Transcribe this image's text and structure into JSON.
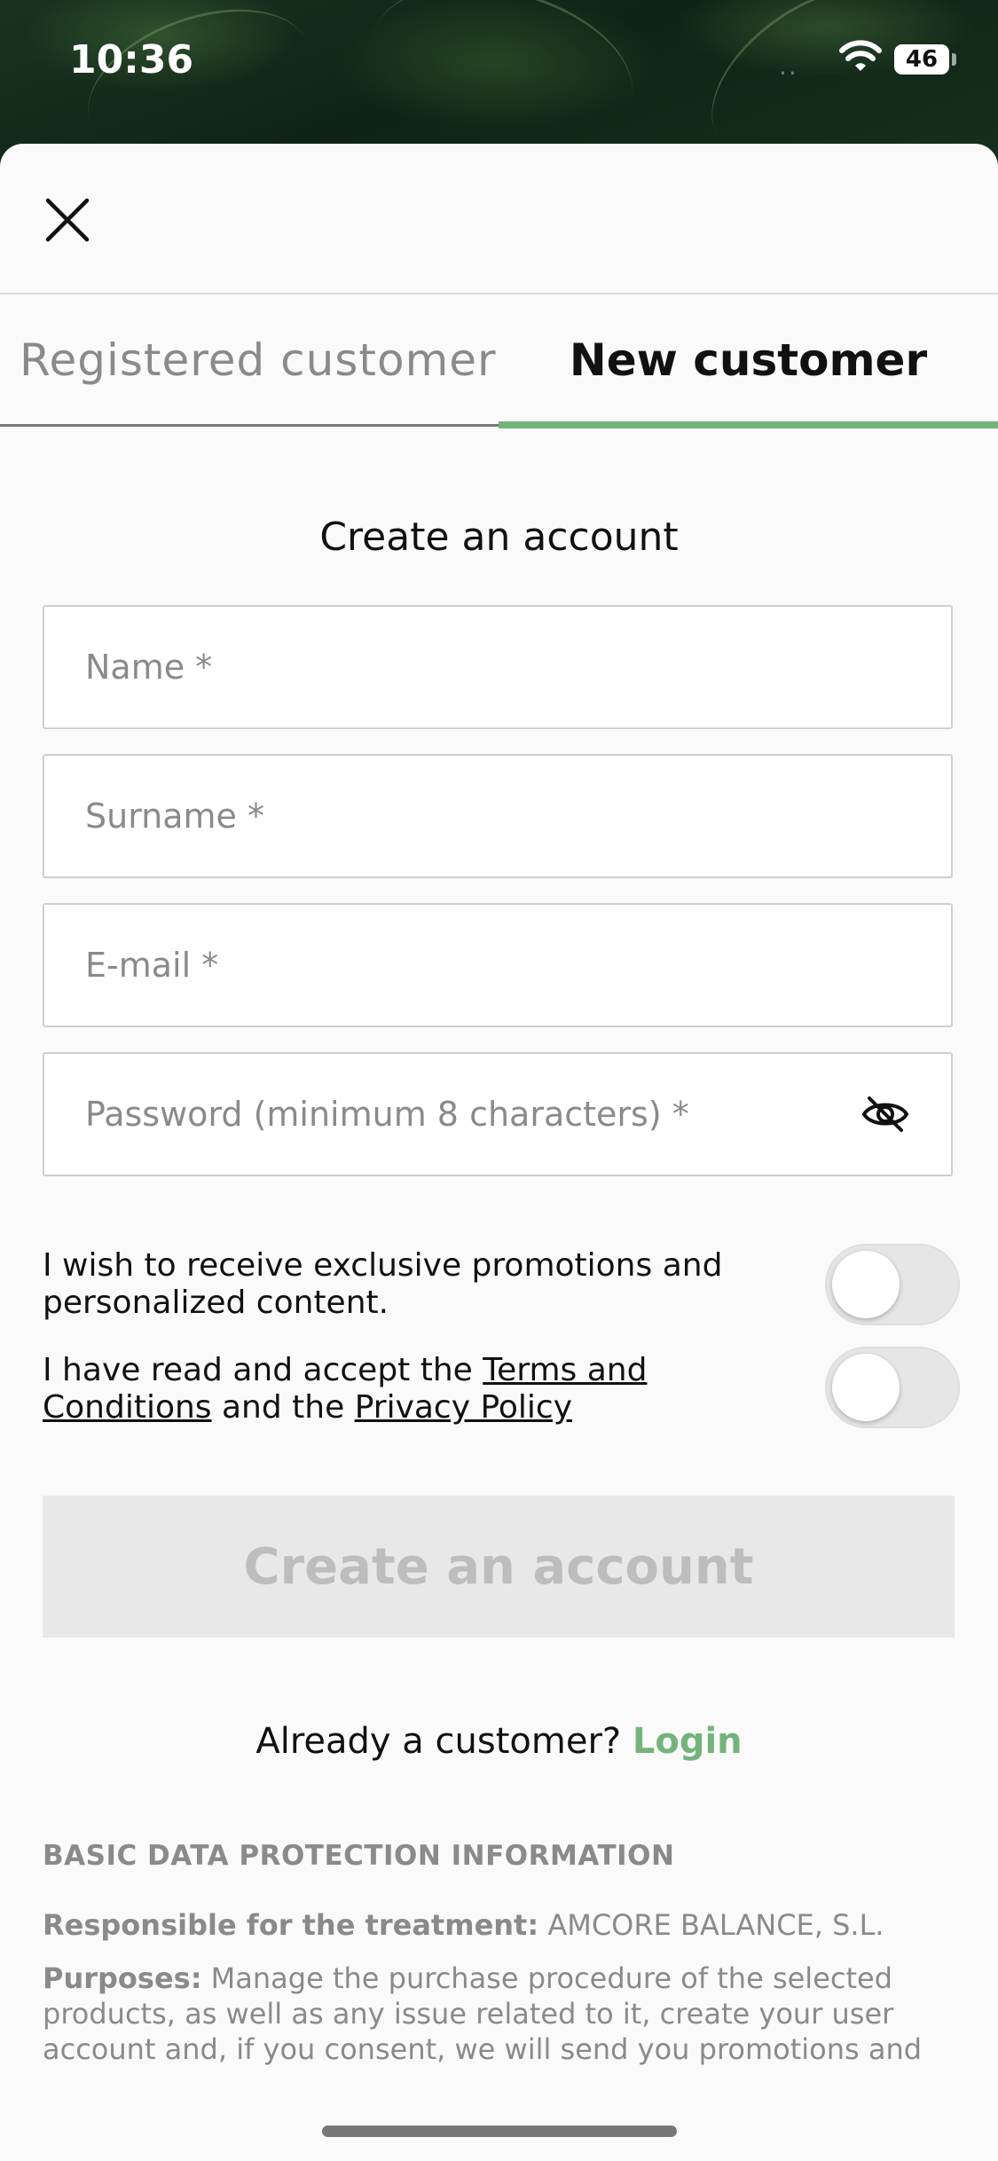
{
  "status_bar": {
    "time": "10:36",
    "signal": "..",
    "battery": "46"
  },
  "tabs": {
    "registered": "Registered customer",
    "new": "New customer",
    "active_color": "#74b47c"
  },
  "form": {
    "title": "Create an account",
    "name_placeholder": "Name *",
    "surname_placeholder": "Surname *",
    "email_placeholder": "E-mail *",
    "password_placeholder": "Password (minimum 8 characters) *"
  },
  "consents": {
    "promotions": "I wish to receive exclusive promotions and personalized content.",
    "terms_prefix": "I have read and accept the ",
    "terms_link": "Terms and Conditions",
    "terms_middle": " and the ",
    "privacy_link": "Privacy Policy"
  },
  "create_button": "Create an account",
  "login_prompt": {
    "text": "Already a customer?",
    "link": "Login"
  },
  "data_protection": {
    "title": "BASIC DATA PROTECTION INFORMATION",
    "responsible_label": "Responsible for the treatment:",
    "responsible_value": "AMCORE BALANCE, S.L.",
    "purposes_label": "Purposes:",
    "purposes_value": "Manage the purchase procedure of the selected products, as well as any issue related to it, create your user account and, if you consent, we will send you promotions and personalized content to the email address, telephone or postal"
  }
}
